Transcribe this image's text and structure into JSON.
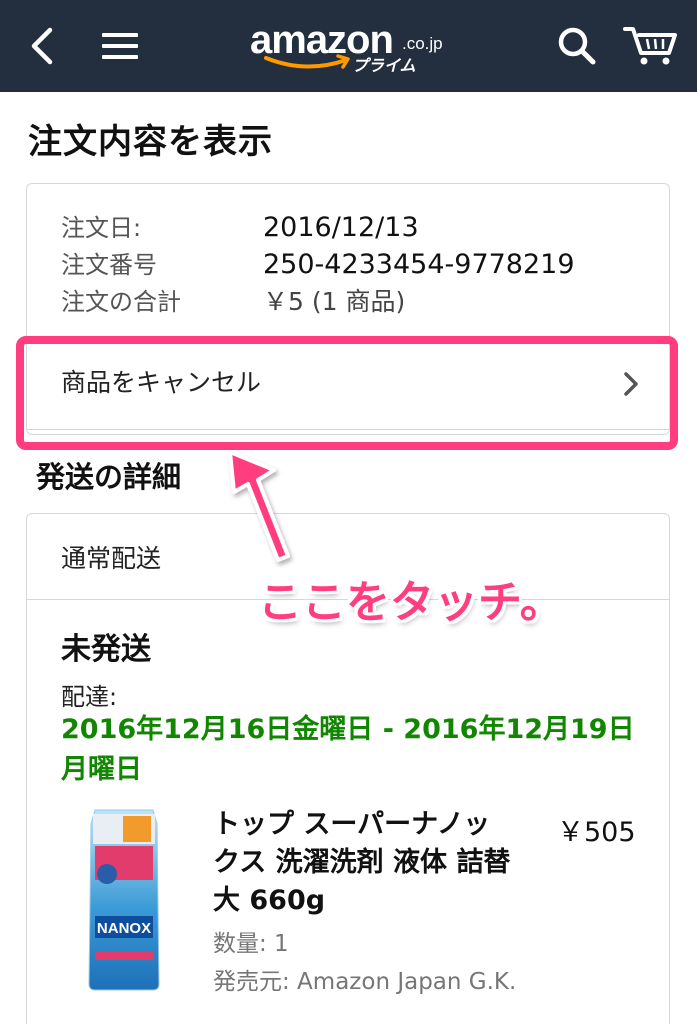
{
  "header": {
    "logo_word": "amazon",
    "logo_tld": ".co.jp",
    "logo_sub": "プライム",
    "icons": [
      "back-icon",
      "menu-icon",
      "search-icon",
      "cart-icon"
    ]
  },
  "page_title": "注文内容を表示",
  "order": {
    "date_label": "注文日:",
    "date_value": "2016/12/13",
    "number_label": "注文番号",
    "number_value": "250-4233454-9778219",
    "total_label": "注文の合計",
    "total_value": "￥5 (1 商品)"
  },
  "cancel": {
    "label": "商品をキャンセル"
  },
  "shipping": {
    "section_title": "発送の詳細",
    "method": "通常配送",
    "status": "未発送",
    "delivery_label": "配達:",
    "delivery_date": "2016年12月16日金曜日 - 2016年12月19日月曜日"
  },
  "product": {
    "name": "トップ スーパーナノックス 洗濯洗剤 液体 詰替大 660g",
    "price": "￥505",
    "quantity": "数量: 1",
    "seller": "発売元: Amazon Japan G.K.",
    "image_text": "NANOX"
  },
  "annotation": {
    "text": "ここをタッチ。"
  },
  "colors": {
    "header_bg": "#232f3e",
    "delivery_green": "#118600",
    "highlight_pink": "#ff3d7f",
    "logo_orange": "#ff9900"
  }
}
